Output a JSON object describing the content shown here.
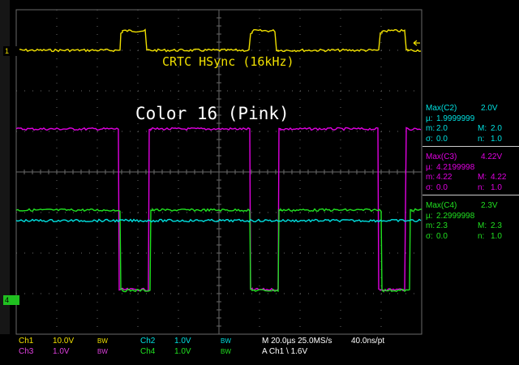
{
  "labels": {
    "hsync": "CRTC HSync (16kHz)",
    "color": "Color 16 (Pink)"
  },
  "markers": {
    "ch1": "1",
    "ch4": "4"
  },
  "measurements": [
    {
      "id": "c2",
      "color": "#00e0e0",
      "max_label": "Max(C2)",
      "max_value": "2.0V",
      "mu_label": "µ:",
      "mu_value": "1.9999999",
      "m_label": "m:",
      "m_value": "2.0",
      "M_label": "M:",
      "M_value": "2.0",
      "sigma_label": "σ:",
      "sigma_value": "0.0",
      "n_label": "n:",
      "n_value": "1.0"
    },
    {
      "id": "c3",
      "color": "#e000e0",
      "max_label": "Max(C3)",
      "max_value": "4.22V",
      "mu_label": "µ:",
      "mu_value": "4.2199998",
      "m_label": "m:",
      "m_value": "4.22",
      "M_label": "M:",
      "M_value": "4.22",
      "sigma_label": "σ:",
      "sigma_value": "0.0",
      "n_label": "n:",
      "n_value": "1.0"
    },
    {
      "id": "c4",
      "color": "#20e020",
      "max_label": "Max(C4)",
      "max_value": "2.3V",
      "mu_label": "µ:",
      "mu_value": "2.2999998",
      "m_label": "m:",
      "m_value": "2.3",
      "M_label": "M:",
      "M_value": "2.3",
      "sigma_label": "σ:",
      "sigma_value": "0.0",
      "n_label": "n:",
      "n_value": "1.0"
    }
  ],
  "status": {
    "ch1_name": "Ch1",
    "ch1_scale": "10.0V",
    "ch1_bw": "BW",
    "ch2_name": "Ch2",
    "ch2_scale": "1.0V",
    "ch2_bw": "BW",
    "ch3_name": "Ch3",
    "ch3_scale": "1.0V",
    "ch3_bw": "BW",
    "ch4_name": "Ch4",
    "ch4_scale": "1.0V",
    "ch4_bw": "BW",
    "timebase": "M 20.0µs 25.0MS/s",
    "resolution": "40.0ns/pt",
    "trigger": "A  Ch1  \\  1.6V"
  },
  "colors": {
    "ch1": "#f0e000",
    "ch2": "#00e0e0",
    "ch3": "#e000e0",
    "ch4": "#20e020",
    "grid": "#6a6a6a",
    "background": "#000000"
  }
}
